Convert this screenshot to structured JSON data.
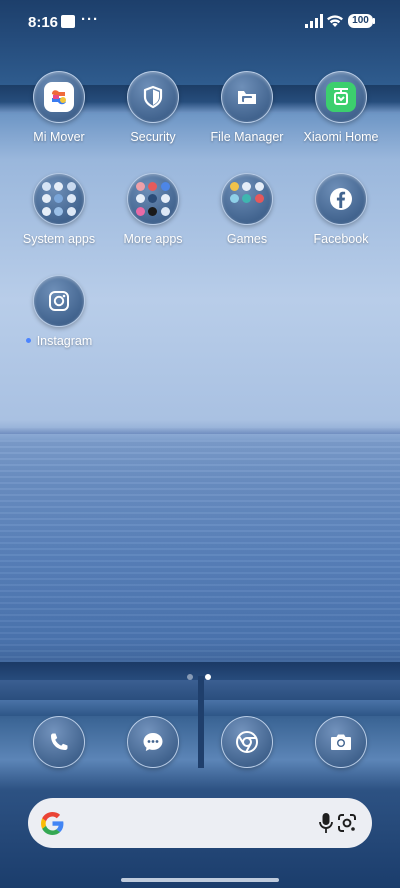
{
  "status_bar": {
    "time": "8:16",
    "more_indicator": "···",
    "battery": "100"
  },
  "apps": [
    {
      "id": "mi-mover",
      "label": "Mi Mover",
      "icon": "mi-mover-icon",
      "unread": false
    },
    {
      "id": "security",
      "label": "Security",
      "icon": "shield-icon",
      "unread": false
    },
    {
      "id": "file-manager",
      "label": "File Manager",
      "icon": "folder-icon",
      "unread": false
    },
    {
      "id": "xiaomi-home",
      "label": "Xiaomi Home",
      "icon": "xiaomi-home-icon",
      "unread": false
    },
    {
      "id": "system-apps",
      "label": "System apps",
      "icon": "folder-grid-icon",
      "unread": false
    },
    {
      "id": "more-apps",
      "label": "More apps",
      "icon": "folder-grid-icon",
      "unread": false
    },
    {
      "id": "games",
      "label": "Games",
      "icon": "folder-grid-icon",
      "unread": false
    },
    {
      "id": "facebook",
      "label": "Facebook",
      "icon": "facebook-icon",
      "unread": false
    },
    {
      "id": "instagram",
      "label": "Instagram",
      "icon": "instagram-icon",
      "unread": true
    }
  ],
  "page_indicator": {
    "pages": 2,
    "current": 2
  },
  "dock": [
    {
      "id": "phone",
      "icon": "phone-icon"
    },
    {
      "id": "messages",
      "icon": "messages-icon"
    },
    {
      "id": "chrome",
      "icon": "chrome-icon"
    },
    {
      "id": "camera",
      "icon": "camera-icon"
    }
  ],
  "search_bar": {
    "logo": "google-g-icon",
    "mic": "microphone-icon",
    "lens": "google-lens-icon"
  },
  "colors": {
    "unread_dot": "#4b84ff",
    "xiaomi_green": "#3ccf6e",
    "mi_mover_tile": "#ffffff"
  }
}
